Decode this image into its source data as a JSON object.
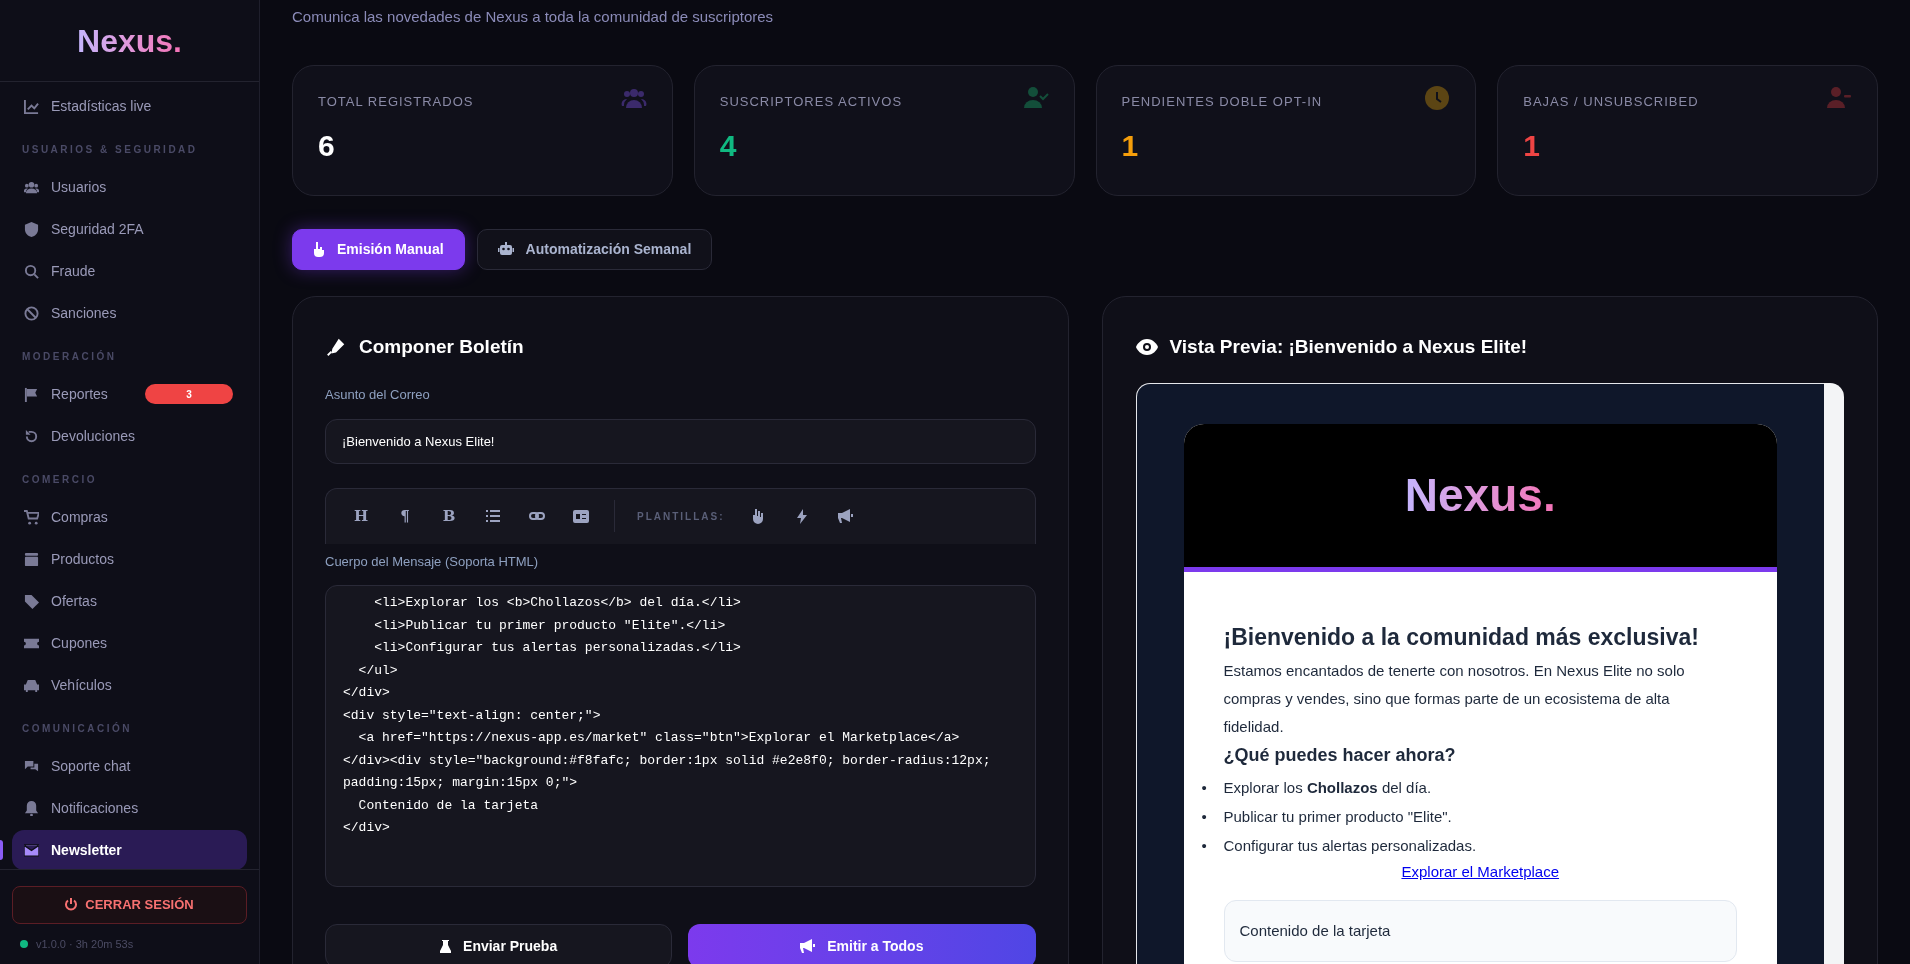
{
  "sidebar": {
    "logo": "Nexus.",
    "items": [
      {
        "kind": "item",
        "label": "Estadísticas live",
        "selected": false
      },
      {
        "kind": "section",
        "label": "USUARIOS & SEGURIDAD"
      },
      {
        "kind": "item",
        "label": "Usuarios",
        "selected": false
      },
      {
        "kind": "item",
        "label": "Seguridad 2FA",
        "selected": false
      },
      {
        "kind": "item",
        "label": "Fraude",
        "selected": false
      },
      {
        "kind": "item",
        "label": "Sanciones",
        "selected": false
      },
      {
        "kind": "section",
        "label": "MODERACIÓN"
      },
      {
        "kind": "item",
        "label": "Reportes",
        "selected": false,
        "badge": "3"
      },
      {
        "kind": "item",
        "label": "Devoluciones",
        "selected": false
      },
      {
        "kind": "section",
        "label": "COMERCIO"
      },
      {
        "kind": "item",
        "label": "Compras",
        "selected": false
      },
      {
        "kind": "item",
        "label": "Productos",
        "selected": false
      },
      {
        "kind": "item",
        "label": "Ofertas",
        "selected": false
      },
      {
        "kind": "item",
        "label": "Cupones",
        "selected": false
      },
      {
        "kind": "item",
        "label": "Vehículos",
        "selected": false
      },
      {
        "kind": "section",
        "label": "COMUNICACIÓN"
      },
      {
        "kind": "item",
        "label": "Soporte chat",
        "selected": false
      },
      {
        "kind": "item",
        "label": "Notificaciones",
        "selected": false
      },
      {
        "kind": "item",
        "label": "Newsletter",
        "selected": true
      }
    ],
    "logout": "CERRAR SESIÓN",
    "version": "v1.0.0 · 3h 20m 53s"
  },
  "subtitle": "Comunica las novedades de Nexus a toda la comunidad de suscriptores",
  "stats": [
    {
      "label": "TOTAL REGISTRADOS",
      "value": "6",
      "color": "#ffffff"
    },
    {
      "label": "SUSCRIPTORES ACTIVOS",
      "value": "4",
      "color": "#10b981"
    },
    {
      "label": "PENDIENTES DOBLE OPT-IN",
      "value": "1",
      "color": "#f59e0b"
    },
    {
      "label": "BAJAS / UNSUBSCRIBED",
      "value": "1",
      "color": "#ef4444"
    }
  ],
  "mode_tabs": [
    {
      "label": "Emisión Manual",
      "selected": true
    },
    {
      "label": "Automatización Semanal",
      "selected": false
    }
  ],
  "composer": {
    "title": "Componer Boletín",
    "subject_label": "Asunto del Correo",
    "subject_value": "¡Bienvenido a Nexus Elite!",
    "toolbar_letters": [
      "H",
      "¶",
      "B"
    ],
    "templates_label": "PLANTILLAS:",
    "body_label": "Cuerpo del Mensaje (Soporta HTML)",
    "body_lines": [
      "    <li>Explorar los <b>Chollazos</b> del día.</li>",
      "    <li>Publicar tu primer producto \"Elite\".</li>",
      "    <li>Configurar tus alertas personalizadas.</li>",
      "  </ul>",
      "</div>",
      "<div style=\"text-align: center;\">",
      "  <a href=\"https://nexus-app.es/market\" class=\"btn\">Explorar el Marketplace</a>",
      "</div><div style=\"background:#f8fafc; border:1px solid #e2e8f0; border-radius:12px;",
      "padding:15px; margin:15px 0;\">",
      "  Contenido de la tarjeta",
      "</div>"
    ],
    "buttons": [
      "Enviar Prueba",
      "Emitir a Todos"
    ]
  },
  "preview": {
    "title": "Vista Previa: ¡Bienvenido a Nexus Elite!",
    "logo": "Nexus.",
    "heading": "¡Bienvenido a la comunidad más exclusiva!",
    "paragraph": "Estamos encantados de tenerte con nosotros. En Nexus Elite no solo compras y vendes, sino que formas parte de un ecosistema de alta fidelidad.",
    "subheading": "¿Qué puedes hacer ahora?",
    "list": [
      {
        "marker": "•",
        "text": "Explorar los **Chollazos** del día."
      },
      {
        "marker": "•",
        "text": "Publicar tu primer producto \"Elite\"."
      },
      {
        "marker": "•",
        "text": "Configurar tus alertas personalizadas."
      }
    ],
    "link": "Explorar el Marketplace",
    "card": "Contenido de la tarjeta"
  }
}
